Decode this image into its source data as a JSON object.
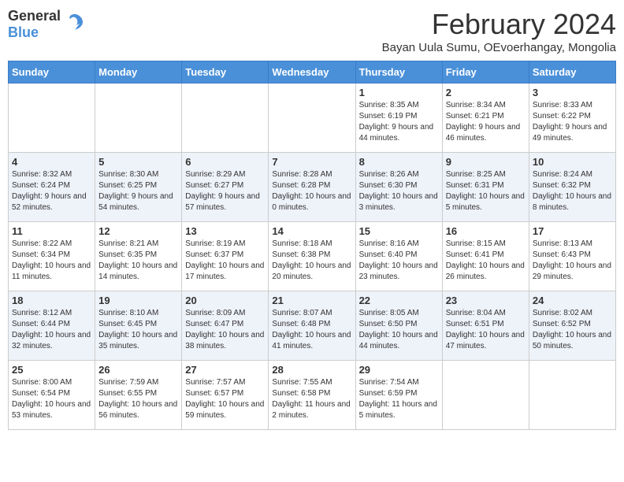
{
  "header": {
    "logo_general": "General",
    "logo_blue": "Blue",
    "month_title": "February 2024",
    "subtitle": "Bayan Uula Sumu, OEvoerhangay, Mongolia"
  },
  "weekdays": [
    "Sunday",
    "Monday",
    "Tuesday",
    "Wednesday",
    "Thursday",
    "Friday",
    "Saturday"
  ],
  "weeks": [
    [
      {
        "day": "",
        "sunrise": "",
        "sunset": "",
        "daylight": ""
      },
      {
        "day": "",
        "sunrise": "",
        "sunset": "",
        "daylight": ""
      },
      {
        "day": "",
        "sunrise": "",
        "sunset": "",
        "daylight": ""
      },
      {
        "day": "",
        "sunrise": "",
        "sunset": "",
        "daylight": ""
      },
      {
        "day": "1",
        "sunrise": "Sunrise: 8:35 AM",
        "sunset": "Sunset: 6:19 PM",
        "daylight": "Daylight: 9 hours and 44 minutes."
      },
      {
        "day": "2",
        "sunrise": "Sunrise: 8:34 AM",
        "sunset": "Sunset: 6:21 PM",
        "daylight": "Daylight: 9 hours and 46 minutes."
      },
      {
        "day": "3",
        "sunrise": "Sunrise: 8:33 AM",
        "sunset": "Sunset: 6:22 PM",
        "daylight": "Daylight: 9 hours and 49 minutes."
      }
    ],
    [
      {
        "day": "4",
        "sunrise": "Sunrise: 8:32 AM",
        "sunset": "Sunset: 6:24 PM",
        "daylight": "Daylight: 9 hours and 52 minutes."
      },
      {
        "day": "5",
        "sunrise": "Sunrise: 8:30 AM",
        "sunset": "Sunset: 6:25 PM",
        "daylight": "Daylight: 9 hours and 54 minutes."
      },
      {
        "day": "6",
        "sunrise": "Sunrise: 8:29 AM",
        "sunset": "Sunset: 6:27 PM",
        "daylight": "Daylight: 9 hours and 57 minutes."
      },
      {
        "day": "7",
        "sunrise": "Sunrise: 8:28 AM",
        "sunset": "Sunset: 6:28 PM",
        "daylight": "Daylight: 10 hours and 0 minutes."
      },
      {
        "day": "8",
        "sunrise": "Sunrise: 8:26 AM",
        "sunset": "Sunset: 6:30 PM",
        "daylight": "Daylight: 10 hours and 3 minutes."
      },
      {
        "day": "9",
        "sunrise": "Sunrise: 8:25 AM",
        "sunset": "Sunset: 6:31 PM",
        "daylight": "Daylight: 10 hours and 5 minutes."
      },
      {
        "day": "10",
        "sunrise": "Sunrise: 8:24 AM",
        "sunset": "Sunset: 6:32 PM",
        "daylight": "Daylight: 10 hours and 8 minutes."
      }
    ],
    [
      {
        "day": "11",
        "sunrise": "Sunrise: 8:22 AM",
        "sunset": "Sunset: 6:34 PM",
        "daylight": "Daylight: 10 hours and 11 minutes."
      },
      {
        "day": "12",
        "sunrise": "Sunrise: 8:21 AM",
        "sunset": "Sunset: 6:35 PM",
        "daylight": "Daylight: 10 hours and 14 minutes."
      },
      {
        "day": "13",
        "sunrise": "Sunrise: 8:19 AM",
        "sunset": "Sunset: 6:37 PM",
        "daylight": "Daylight: 10 hours and 17 minutes."
      },
      {
        "day": "14",
        "sunrise": "Sunrise: 8:18 AM",
        "sunset": "Sunset: 6:38 PM",
        "daylight": "Daylight: 10 hours and 20 minutes."
      },
      {
        "day": "15",
        "sunrise": "Sunrise: 8:16 AM",
        "sunset": "Sunset: 6:40 PM",
        "daylight": "Daylight: 10 hours and 23 minutes."
      },
      {
        "day": "16",
        "sunrise": "Sunrise: 8:15 AM",
        "sunset": "Sunset: 6:41 PM",
        "daylight": "Daylight: 10 hours and 26 minutes."
      },
      {
        "day": "17",
        "sunrise": "Sunrise: 8:13 AM",
        "sunset": "Sunset: 6:43 PM",
        "daylight": "Daylight: 10 hours and 29 minutes."
      }
    ],
    [
      {
        "day": "18",
        "sunrise": "Sunrise: 8:12 AM",
        "sunset": "Sunset: 6:44 PM",
        "daylight": "Daylight: 10 hours and 32 minutes."
      },
      {
        "day": "19",
        "sunrise": "Sunrise: 8:10 AM",
        "sunset": "Sunset: 6:45 PM",
        "daylight": "Daylight: 10 hours and 35 minutes."
      },
      {
        "day": "20",
        "sunrise": "Sunrise: 8:09 AM",
        "sunset": "Sunset: 6:47 PM",
        "daylight": "Daylight: 10 hours and 38 minutes."
      },
      {
        "day": "21",
        "sunrise": "Sunrise: 8:07 AM",
        "sunset": "Sunset: 6:48 PM",
        "daylight": "Daylight: 10 hours and 41 minutes."
      },
      {
        "day": "22",
        "sunrise": "Sunrise: 8:05 AM",
        "sunset": "Sunset: 6:50 PM",
        "daylight": "Daylight: 10 hours and 44 minutes."
      },
      {
        "day": "23",
        "sunrise": "Sunrise: 8:04 AM",
        "sunset": "Sunset: 6:51 PM",
        "daylight": "Daylight: 10 hours and 47 minutes."
      },
      {
        "day": "24",
        "sunrise": "Sunrise: 8:02 AM",
        "sunset": "Sunset: 6:52 PM",
        "daylight": "Daylight: 10 hours and 50 minutes."
      }
    ],
    [
      {
        "day": "25",
        "sunrise": "Sunrise: 8:00 AM",
        "sunset": "Sunset: 6:54 PM",
        "daylight": "Daylight: 10 hours and 53 minutes."
      },
      {
        "day": "26",
        "sunrise": "Sunrise: 7:59 AM",
        "sunset": "Sunset: 6:55 PM",
        "daylight": "Daylight: 10 hours and 56 minutes."
      },
      {
        "day": "27",
        "sunrise": "Sunrise: 7:57 AM",
        "sunset": "Sunset: 6:57 PM",
        "daylight": "Daylight: 10 hours and 59 minutes."
      },
      {
        "day": "28",
        "sunrise": "Sunrise: 7:55 AM",
        "sunset": "Sunset: 6:58 PM",
        "daylight": "Daylight: 11 hours and 2 minutes."
      },
      {
        "day": "29",
        "sunrise": "Sunrise: 7:54 AM",
        "sunset": "Sunset: 6:59 PM",
        "daylight": "Daylight: 11 hours and 5 minutes."
      },
      {
        "day": "",
        "sunrise": "",
        "sunset": "",
        "daylight": ""
      },
      {
        "day": "",
        "sunrise": "",
        "sunset": "",
        "daylight": ""
      }
    ]
  ]
}
